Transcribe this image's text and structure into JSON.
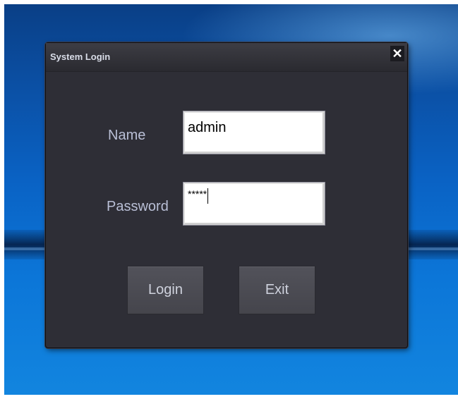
{
  "window": {
    "title": "System Login",
    "close_symbol": "✕"
  },
  "form": {
    "name_label": "Name",
    "name_value": "admin",
    "password_label": "Password",
    "password_value": "*****"
  },
  "buttons": {
    "login_label": "Login",
    "exit_label": "Exit"
  },
  "colors": {
    "window_bg": "#2e2e36",
    "label_text": "#b9bfd6",
    "desktop_blue": "#0a62c4"
  },
  "icons": {
    "close": "close-icon"
  }
}
